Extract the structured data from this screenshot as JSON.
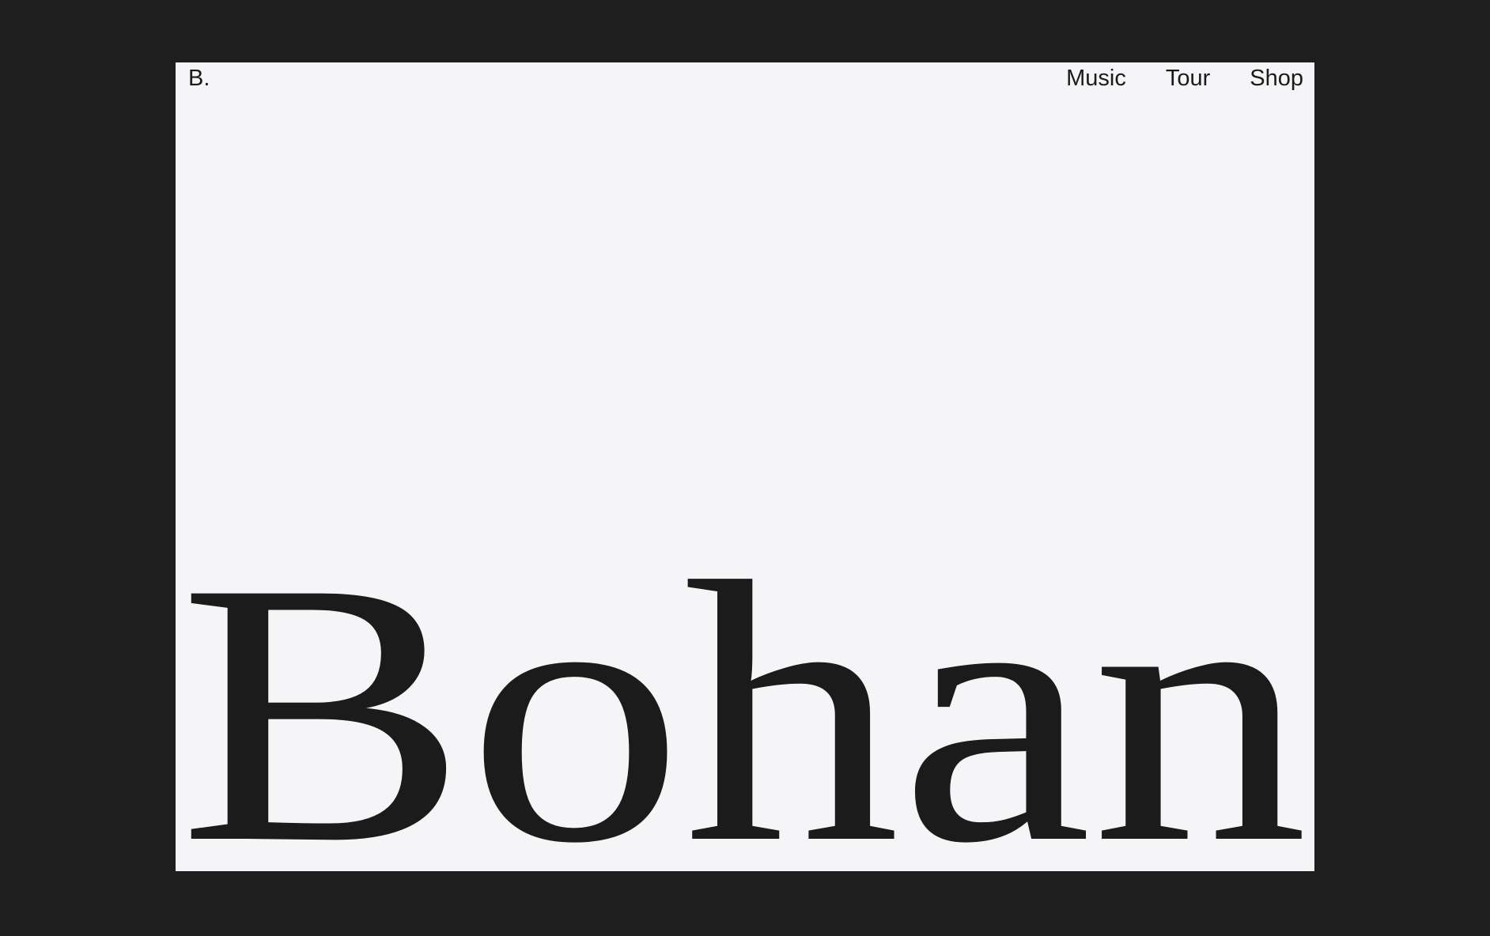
{
  "brand": {
    "logo": "B.",
    "wordmark": "Bohan"
  },
  "nav": {
    "items": [
      {
        "label": "Music"
      },
      {
        "label": "Tour"
      },
      {
        "label": "Shop"
      }
    ]
  },
  "colors": {
    "outer_background": "#1e1e1e",
    "page_background": "#f5f5f7",
    "text": "#1b1b1b"
  }
}
